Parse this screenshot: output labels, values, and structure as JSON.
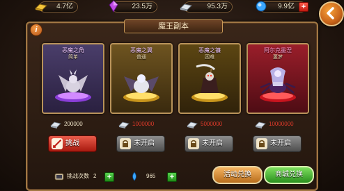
{
  "resources": [
    {
      "name": "gold",
      "value": "4.7亿",
      "icon": "gold-bar-icon",
      "color": "#f2c43a"
    },
    {
      "name": "crystal",
      "value": "23.5万",
      "icon": "purple-crystal-icon",
      "color": "#c04be6"
    },
    {
      "name": "silver",
      "value": "95.3万",
      "icon": "silver-bar-icon",
      "color": "#c8d2dc"
    },
    {
      "name": "diamond",
      "value": "9.9亿",
      "icon": "blue-diamond-icon",
      "color": "#3aa6ff"
    }
  ],
  "panel": {
    "title": "魔王副本",
    "info_label": "i"
  },
  "cards": [
    {
      "name": "恶魔之角",
      "sub": "简单",
      "cost": "200000",
      "button": "挑战",
      "button_icon": "attack-icon",
      "status": "open",
      "theme": "#6a5890",
      "pedestal": "#b05aff",
      "cost_color": "#f3e8cc"
    },
    {
      "name": "恶魔之翼",
      "sub": "普通",
      "cost": "1000000",
      "button": "未开启",
      "button_icon": "lock-icon",
      "status": "locked",
      "theme": "#b08a2a",
      "pedestal": "#ffd45a",
      "cost_color": "#e23a2a"
    },
    {
      "name": "恶魔之镰",
      "sub": "困难",
      "cost": "5000000",
      "button": "未开启",
      "button_icon": "lock-icon",
      "status": "locked",
      "theme": "#9c7a24",
      "pedestal": "#ffd45a",
      "cost_color": "#e23a2a"
    },
    {
      "name": "阿尔克墨涅",
      "sub": "噩梦",
      "cost": "10000000",
      "button": "未开启",
      "button_icon": "lock-icon",
      "status": "locked",
      "theme": "#b2283a",
      "pedestal": "#ff3a3a",
      "cost_color": "#e23a2a"
    }
  ],
  "bottom": {
    "challenge_label": "挑战次数",
    "challenge_count": "2",
    "gem_count": "965",
    "activity_exchange": "活动兑换",
    "shop_exchange": "商城兑换"
  }
}
